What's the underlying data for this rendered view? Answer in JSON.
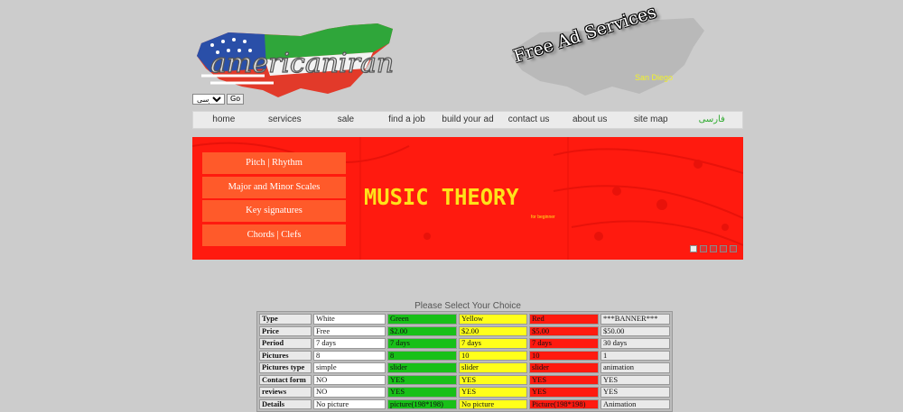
{
  "header": {
    "logo_text": "americaniran",
    "language_select": "فارسی",
    "go_button": "Go",
    "ad_title": "Free Ad Services",
    "ad_city": "San Diego"
  },
  "nav": {
    "items": [
      "home",
      "services",
      "sale",
      "find a job",
      "build your ad",
      "contact us",
      "about us",
      "site map",
      "فارسی"
    ]
  },
  "banner": {
    "menu": [
      "Pitch | Rhythm",
      "Major and Minor Scales",
      "Key signatures",
      "Chords | Clefs"
    ],
    "title": "MUSIC THEORY",
    "subtitle": "for beginner",
    "slides": 5,
    "active_slide": 1
  },
  "plans": {
    "caption": "Please Select Your Choice",
    "rows": [
      [
        "Type",
        "White",
        "Green",
        "Yellow",
        "Red",
        "***BANNER***"
      ],
      [
        "Price",
        "Free",
        "$2.00",
        "$2.00",
        "$5.00",
        "$50.00"
      ],
      [
        "Period",
        "7 days",
        "7 days",
        "7 days",
        "7 days",
        "30 days"
      ],
      [
        "Pictures",
        "8",
        "8",
        "10",
        "10",
        "1"
      ],
      [
        "Pictures type",
        "simple",
        "slider",
        "slider",
        "slider",
        "animation"
      ],
      [
        "Contact form",
        "NO",
        "YES",
        "YES",
        "YES",
        "YES"
      ],
      [
        "reviews",
        "NO",
        "YES",
        "YES",
        "YES",
        "YES"
      ],
      [
        "Details",
        "No picture",
        "picture(198*198)",
        "No picture",
        "Picture(198*198)",
        "Animation"
      ]
    ]
  },
  "colors": {
    "banner": "#ff1a0f",
    "green": "#18c018",
    "yellow": "#ffff1a",
    "red": "#ff1a0f",
    "nav_persian": "#2faa2f"
  }
}
